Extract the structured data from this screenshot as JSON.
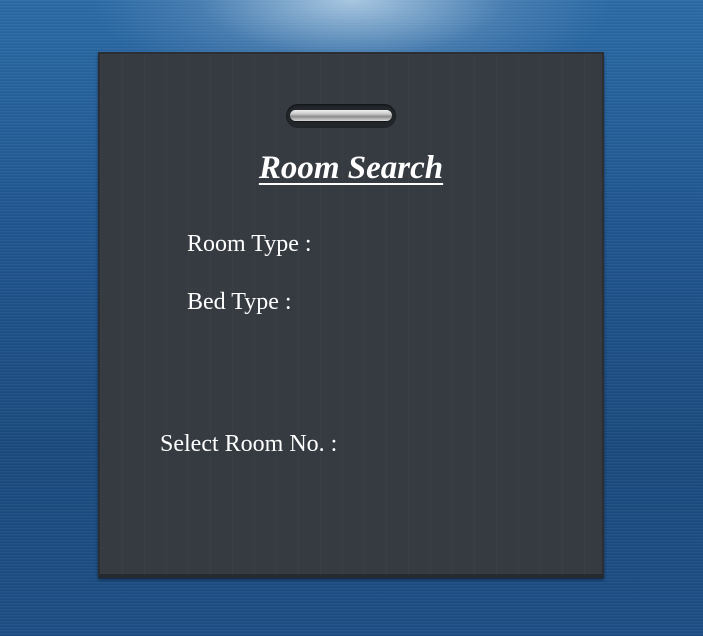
{
  "form": {
    "title": "Room Search",
    "room_type_label": "Room Type :",
    "bed_type_label": "Bed Type :",
    "room_no_label": "Select Room No. :"
  },
  "colors": {
    "background": "#1d4f86",
    "panel": "#363b41",
    "text": "#ffffff"
  }
}
